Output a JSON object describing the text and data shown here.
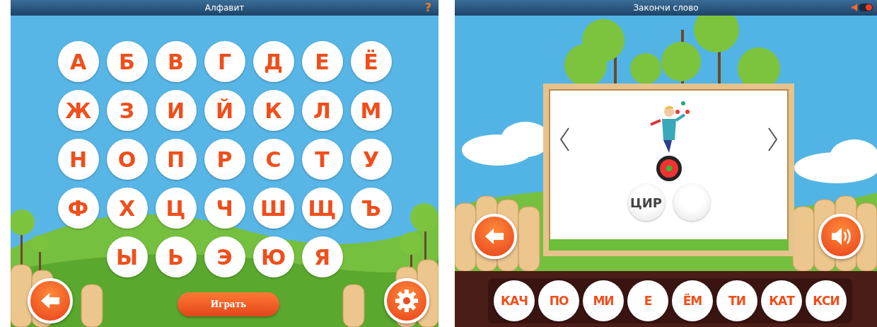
{
  "alphabet_screen": {
    "title": "Алфавит",
    "help_icon": "?",
    "letter_rows": [
      [
        "А",
        "Б",
        "В",
        "Г",
        "Д",
        "Е",
        "Ё"
      ],
      [
        "Ж",
        "З",
        "И",
        "Й",
        "К",
        "Л",
        "М"
      ],
      [
        "Н",
        "О",
        "П",
        "Р",
        "С",
        "Т",
        "У"
      ],
      [
        "Ф",
        "Х",
        "Ц",
        "Ч",
        "Ш",
        "Щ",
        "Ъ"
      ],
      [
        "Ы",
        "Ь",
        "Э",
        "Ю",
        "Я"
      ]
    ],
    "play_button": "Играть"
  },
  "word_screen": {
    "title": "Закончи слово",
    "sound_toggle": {
      "on": true
    },
    "filled_syllable": "ЦИР",
    "syllables": [
      "КАЧ",
      "ПО",
      "МИ",
      "Е",
      "ЁМ",
      "ТИ",
      "КАТ",
      "КСИ"
    ]
  }
}
